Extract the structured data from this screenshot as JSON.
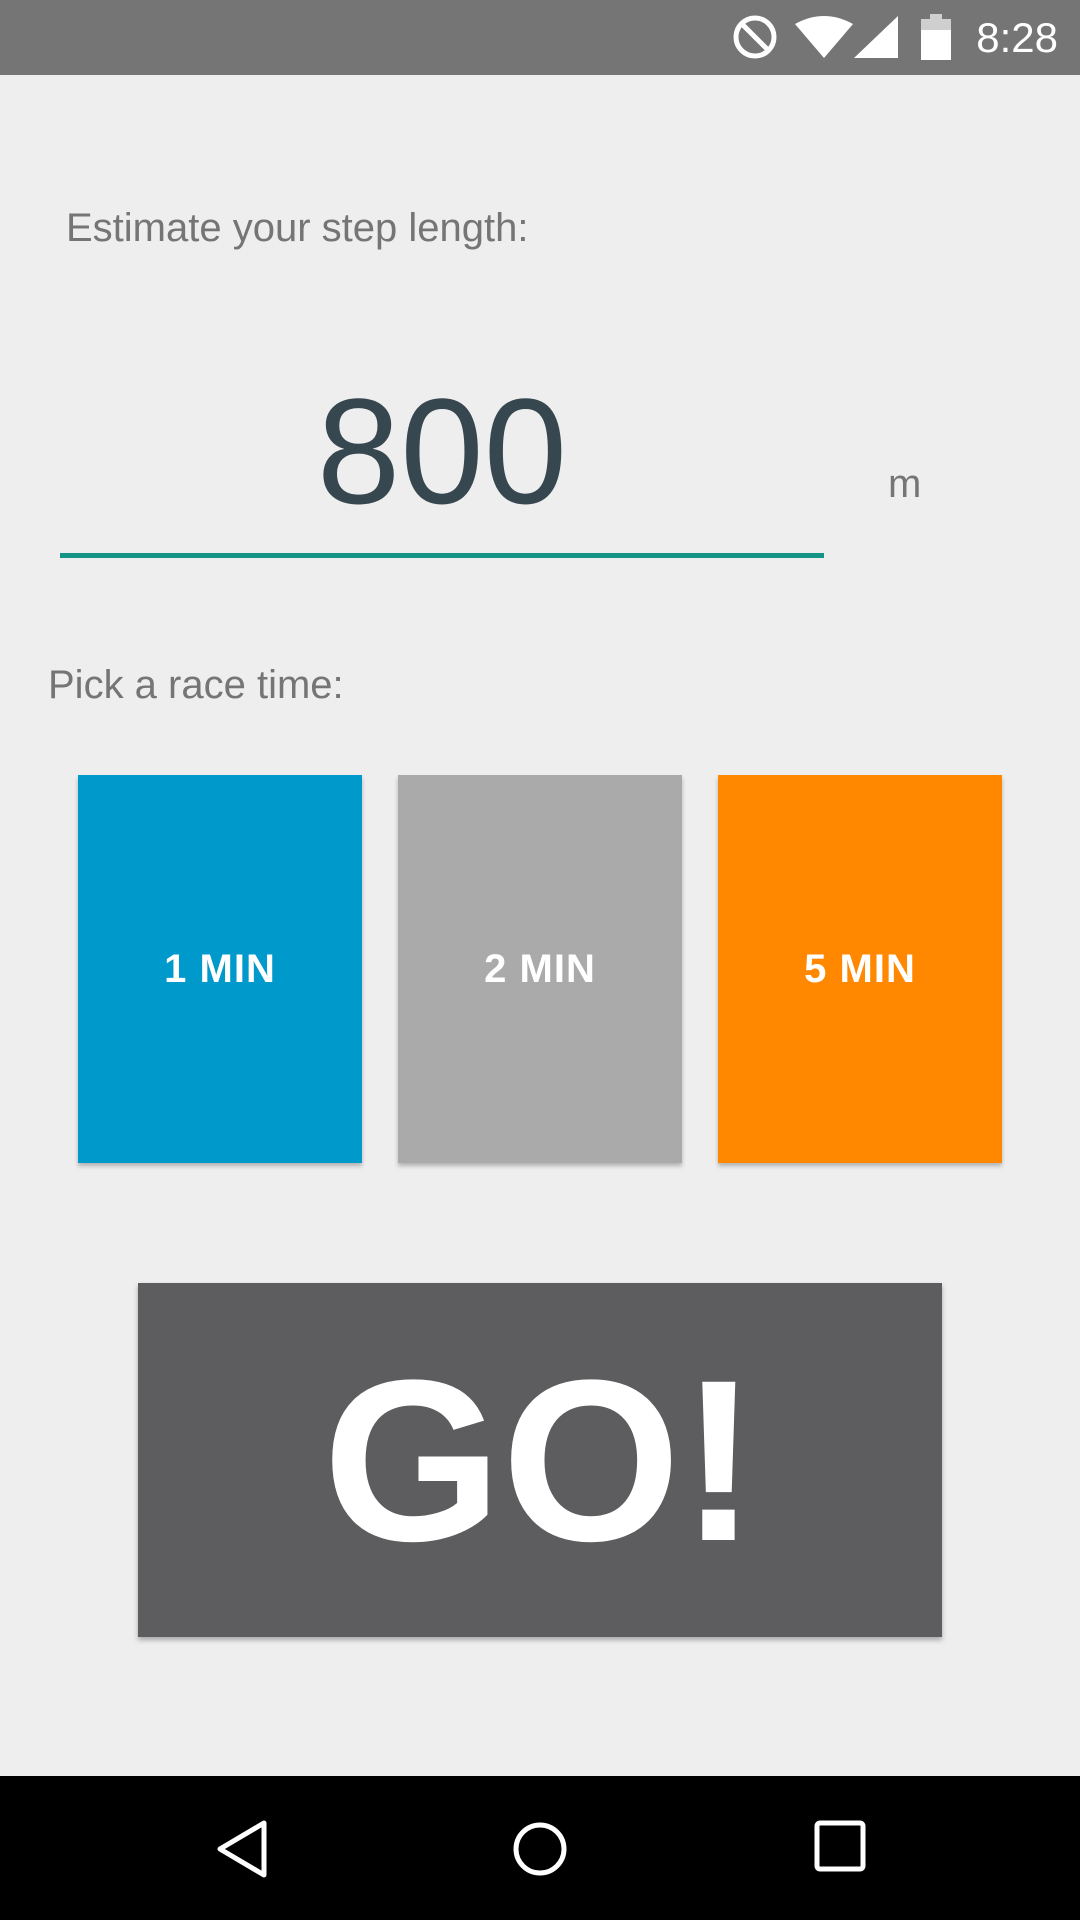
{
  "status_bar": {
    "time": "8:28",
    "icons": [
      "do-not-disturb-icon",
      "wifi-icon",
      "cell-signal-icon",
      "battery-icon"
    ]
  },
  "step_length": {
    "label": "Estimate your step length:",
    "value": "800",
    "unit": "m"
  },
  "race_time": {
    "label": "Pick a race time:",
    "options": [
      {
        "label": "1 MIN",
        "color": "#0099cc"
      },
      {
        "label": "2 MIN",
        "color": "#aaaaaa"
      },
      {
        "label": "5 MIN",
        "color": "#ff8800"
      }
    ]
  },
  "go_button": {
    "label": "GO!",
    "color": "#5d5d5f"
  },
  "nav_bar": {
    "icons": [
      "back-icon",
      "home-icon",
      "recents-icon"
    ]
  },
  "colors": {
    "accent": "#139486",
    "status_bar": "#757575",
    "background": "#eeeeee"
  }
}
